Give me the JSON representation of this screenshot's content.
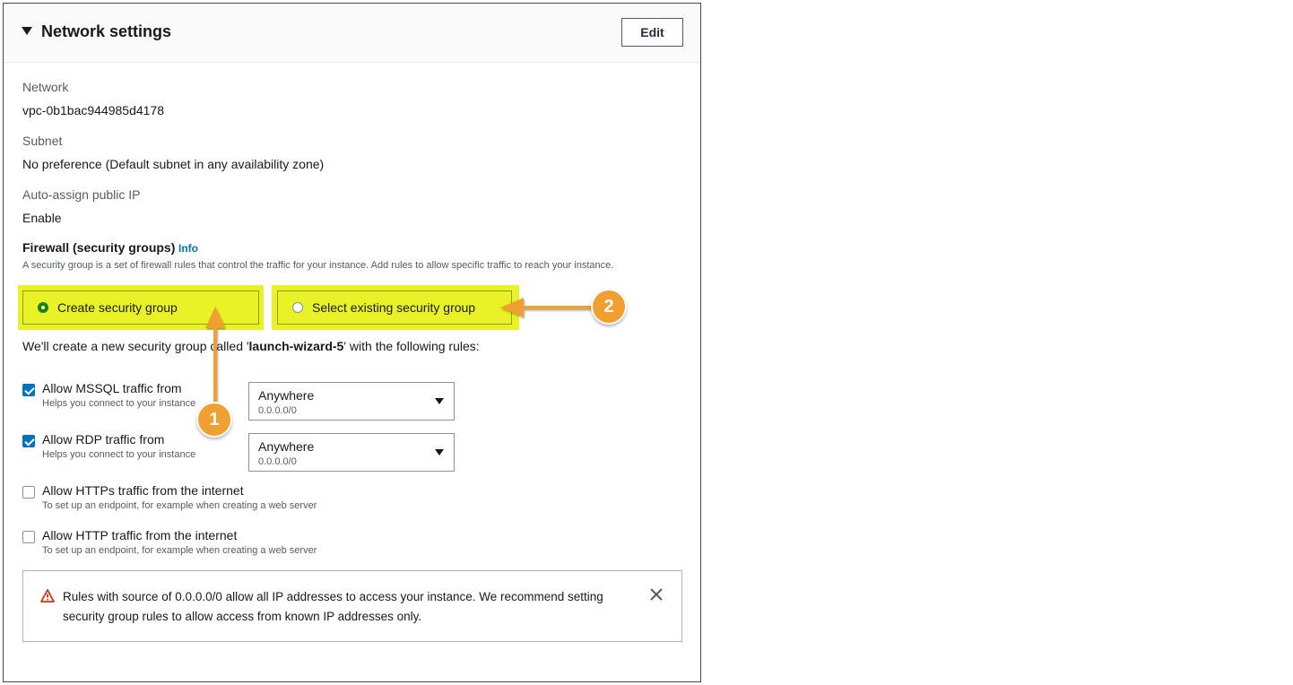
{
  "section": {
    "title": "Network settings",
    "edit_label": "Edit"
  },
  "fields": {
    "network_label": "Network",
    "network_value": "vpc-0b1bac944985d4178",
    "subnet_label": "Subnet",
    "subnet_value": "No preference (Default subnet in any availability zone)",
    "autoip_label": "Auto-assign public IP",
    "autoip_value": "Enable"
  },
  "firewall": {
    "title": "Firewall (security groups)",
    "info_label": "Info",
    "description": "A security group is a set of firewall rules that control the traffic for your instance. Add rules to allow specific traffic to reach your instance.",
    "option_create": "Create security group",
    "option_existing": "Select existing security group",
    "selected": "Create security group",
    "create_note_prefix": "We'll create a new security group called '",
    "create_note_name": "launch-wizard-5",
    "create_note_suffix": "' with the following rules:"
  },
  "rules": [
    {
      "label": "Allow MSSQL traffic from",
      "help": "Helps you connect to your instance",
      "checked": true,
      "source": "Anywhere",
      "source_sub": "0.0.0.0/0"
    },
    {
      "label": "Allow RDP traffic from",
      "help": "Helps you connect to your instance",
      "checked": true,
      "source": "Anywhere",
      "source_sub": "0.0.0.0/0"
    },
    {
      "label": "Allow HTTPs traffic from the internet",
      "help": "To set up an endpoint, for example when creating a web server",
      "checked": false
    },
    {
      "label": "Allow HTTP traffic from the internet",
      "help": "To set up an endpoint, for example when creating a web server",
      "checked": false
    }
  ],
  "alert": {
    "text": "Rules with source of 0.0.0.0/0 allow all IP addresses to access your instance. We recommend setting security group rules to allow access from known IP addresses only.",
    "icon": "warning-icon",
    "close_icon": "close-icon"
  },
  "annotations": {
    "badge_1": "1",
    "badge_2": "2"
  },
  "colors": {
    "highlight": "#e8f227",
    "annotation": "#f0a030",
    "selected_radio": "#1d8102",
    "checkbox": "#0073bb",
    "link": "#0073bb",
    "warning": "#d13212"
  }
}
